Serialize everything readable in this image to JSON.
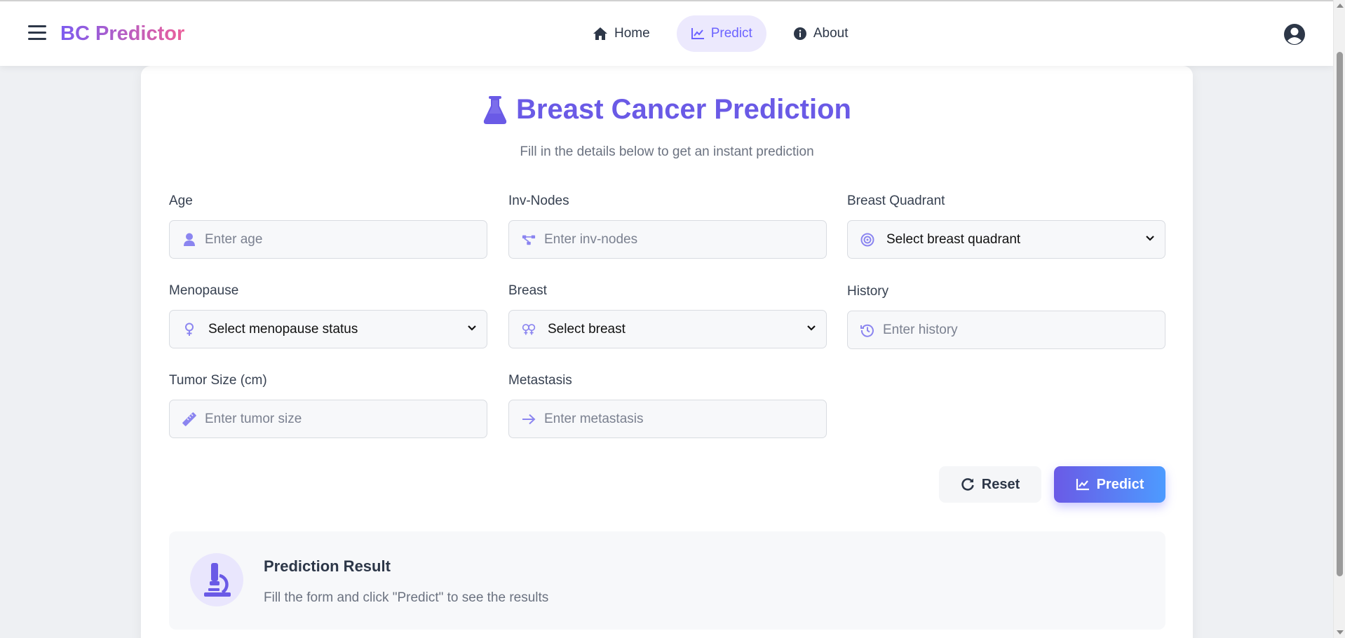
{
  "navbar": {
    "brand": "BC Predictor",
    "links": [
      {
        "label": "Home",
        "icon": "home-icon",
        "active": false
      },
      {
        "label": "Predict",
        "icon": "chart-line-icon",
        "active": true
      },
      {
        "label": "About",
        "icon": "info-icon",
        "active": false
      }
    ]
  },
  "form": {
    "title": "Breast Cancer Prediction",
    "subtitle": "Fill in the details below to get an instant prediction",
    "age": {
      "label": "Age",
      "placeholder": "Enter age",
      "icon": "user-icon"
    },
    "inv_nodes": {
      "label": "Inv-Nodes",
      "placeholder": "Enter inv-nodes",
      "icon": "nodes-icon"
    },
    "breast_quadrant": {
      "label": "Breast Quadrant",
      "selected": "Select breast quadrant",
      "icon": "target-icon"
    },
    "menopause": {
      "label": "Menopause",
      "selected": "Select menopause status",
      "icon": "venus-icon"
    },
    "breast": {
      "label": "Breast",
      "selected": "Select breast",
      "icon": "venus-double-icon"
    },
    "history": {
      "label": "History",
      "placeholder": "Enter history",
      "icon": "history-icon"
    },
    "tumor_size": {
      "label": "Tumor Size (cm)",
      "placeholder": "Enter tumor size",
      "icon": "ruler-icon"
    },
    "metastasis": {
      "label": "Metastasis",
      "placeholder": "Enter metastasis",
      "icon": "arrow-right-icon"
    },
    "reset_label": "Reset",
    "predict_label": "Predict"
  },
  "result": {
    "title": "Prediction Result",
    "message": "Fill the form and click \"Predict\" to see the results",
    "icon": "microscope-icon"
  },
  "colors": {
    "accent": "#6c63ff",
    "accent_light": "#ece9fd",
    "brand_gradient_start": "#7c5cf0",
    "brand_gradient_end": "#ec5f9a",
    "predict_gradient_end": "#4d9bff"
  }
}
